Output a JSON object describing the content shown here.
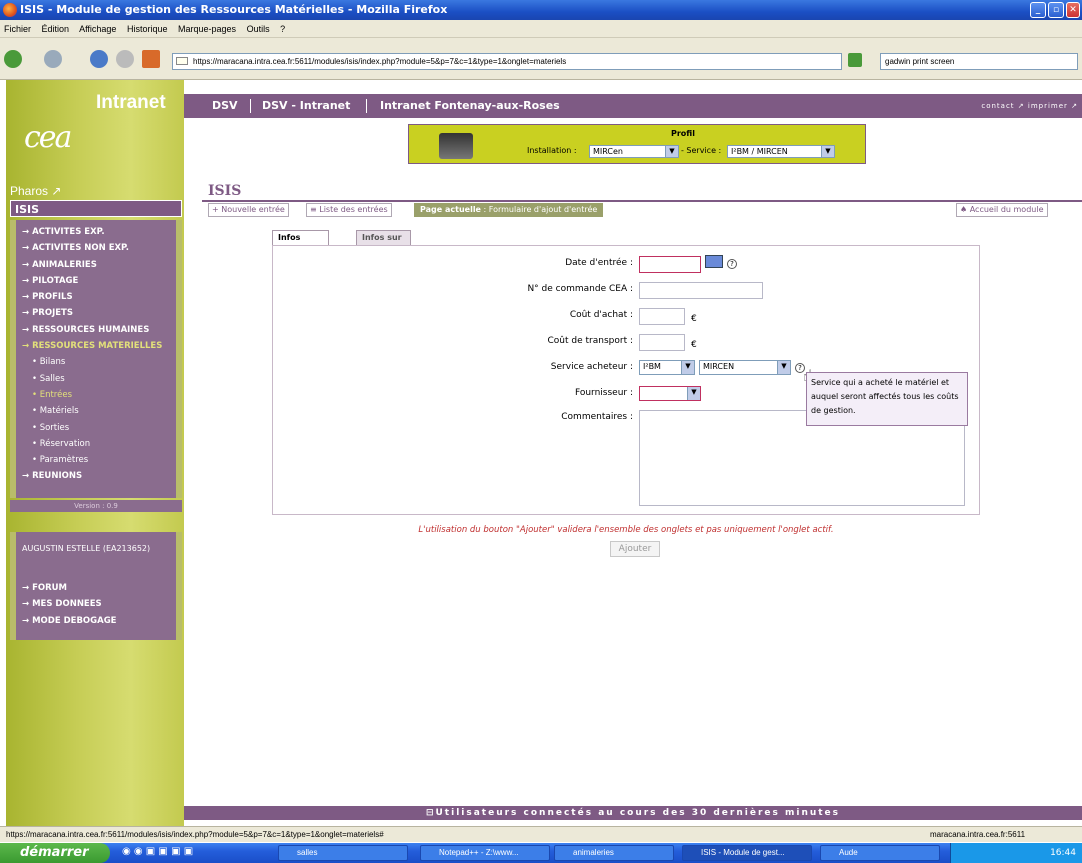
{
  "window": {
    "title": "ISIS - Module de gestion des Ressources Matérielles - Mozilla Firefox"
  },
  "menu": [
    "Fichier",
    "Édition",
    "Affichage",
    "Historique",
    "Marque-pages",
    "Outils",
    "?"
  ],
  "browser": {
    "url": "https://maracana.intra.cea.fr:5611/modules/isis/index.php?module=5&p=7&c=1&type=1&onglet=materiels",
    "search": "gadwin print screen"
  },
  "sidebar": {
    "logo": "cea",
    "intranet": "Intranet",
    "pharos": "Pharos ↗",
    "section": "ISIS",
    "items": [
      {
        "label": "→ ACTIVITES EXP."
      },
      {
        "label": "→ ACTIVITES NON EXP."
      },
      {
        "label": "→ ANIMALERIES"
      },
      {
        "label": "→ PILOTAGE"
      },
      {
        "label": "→ PROFILS"
      },
      {
        "label": "→ PROJETS"
      },
      {
        "label": "→ RESSOURCES HUMAINES"
      },
      {
        "label": "→ RESSOURCES MATERIELLES"
      },
      {
        "label": "• Bilans"
      },
      {
        "label": "• Salles"
      },
      {
        "label": "• Entrées"
      },
      {
        "label": "• Matériels"
      },
      {
        "label": "• Sorties"
      },
      {
        "label": "• Réservation"
      },
      {
        "label": "• Paramètres"
      },
      {
        "label": "→ REUNIONS"
      }
    ],
    "version": "Version : 0.9",
    "user": "AUGUSTIN ESTELLE (EA213652)",
    "user_items": [
      {
        "label": "→ FORUM"
      },
      {
        "label": "→ MES DONNEES"
      },
      {
        "label": "→ MODE DEBOGAGE"
      }
    ]
  },
  "header": {
    "dsv": "DSV",
    "dsv_intranet": "DSV - Intranet",
    "fontenay": "Intranet Fontenay-aux-Roses",
    "contact": "contact ↗ imprimer ↗"
  },
  "profil": {
    "title": "Profil",
    "installation_label": "Installation :",
    "installation_value": "MIRCen",
    "service_label": "- Service :",
    "service_value": "I²BM / MIRCEN"
  },
  "page": {
    "title": "ISIS",
    "new_entry": "+ Nouvelle entrée",
    "list_entries": "≡ Liste des entrées",
    "current_label": "Page actuelle",
    "current_value": " : Formulaire d'ajout d'entrée",
    "home": "♠ Accueil du module"
  },
  "tabs": {
    "general": "Infos générales",
    "materials": "Infos sur les matériels"
  },
  "form": {
    "date_label": "Date d'entrée :",
    "order_label": "N° de commande CEA :",
    "cost_label": "Coût d'achat :",
    "transport_label": "Coût de transport :",
    "service_label": "Service acheteur :",
    "supplier_label": "Fournisseur :",
    "comments_label": "Commentaires :",
    "euro": "€",
    "service_value1": "I²BM",
    "service_value2": "MIRCEN",
    "tooltip": "Service qui a acheté le matériel et auquel seront affectés tous les coûts de gestion."
  },
  "note": "L'utilisation du bouton \"Ajouter\" validera l'ensemble des onglets et pas uniquement l'onglet actif.",
  "add_button": "Ajouter",
  "footer": "⊟Utilisateurs connectés au cours des 30 dernières minutes",
  "status": {
    "url": "https://maracana.intra.cea.fr:5611/modules/isis/index.php?module=5&p=7&c=1&type=1&onglet=materiels#",
    "host": "maracana.intra.cea.fr:5611"
  },
  "taskbar": {
    "start": "démarrer",
    "tasks": [
      {
        "label": "salles"
      },
      {
        "label": "Notepad++ - Z:\\www..."
      },
      {
        "label": "animaleries"
      },
      {
        "label": "ISIS - Module de gest..."
      },
      {
        "label": "Aude"
      }
    ],
    "clock": "16:44"
  }
}
